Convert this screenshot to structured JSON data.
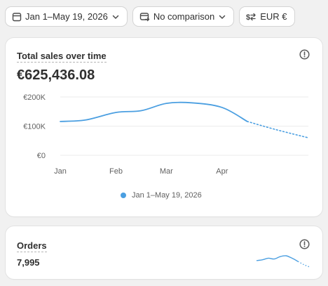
{
  "toolbar": {
    "date_range_label": "Jan 1–May 19, 2026",
    "comparison_label": "No comparison",
    "currency_label": "EUR €"
  },
  "sales_card": {
    "title": "Total sales over time",
    "value": "€625,436.08",
    "legend_label": "Jan 1–May 19, 2026"
  },
  "orders_card": {
    "title": "Orders",
    "value": "7,995"
  },
  "colors": {
    "series": "#4b9fe1",
    "accent_text": "#303030"
  },
  "chart_data": {
    "type": "line",
    "title": "Total sales over time",
    "xlabel": "",
    "ylabel": "",
    "y_tick_labels": [
      "€200K",
      "€100K",
      "€0"
    ],
    "y_ticks": [
      200000,
      100000,
      0
    ],
    "x_tick_labels": [
      "Jan",
      "Feb",
      "Mar",
      "Apr"
    ],
    "ylim": [
      0,
      200000
    ],
    "grid": true,
    "legend_position": "bottom",
    "series": [
      {
        "name": "Jan 1–May 19, 2026",
        "x": [
          "2026-01-01",
          "2026-01-15",
          "2026-02-01",
          "2026-02-15",
          "2026-03-01",
          "2026-03-15",
          "2026-04-01",
          "2026-04-15",
          "2026-05-01",
          "2026-05-19"
        ],
        "y": [
          116000,
          121000,
          147000,
          153000,
          178000,
          180000,
          164000,
          116000,
          88000,
          60000
        ],
        "solid_until_index": 7
      }
    ]
  },
  "orders_sparkline": {
    "type": "line",
    "y": [
      20,
      22,
      26,
      24,
      30,
      32,
      26,
      18,
      10,
      4
    ],
    "solid_until_index": 7
  }
}
